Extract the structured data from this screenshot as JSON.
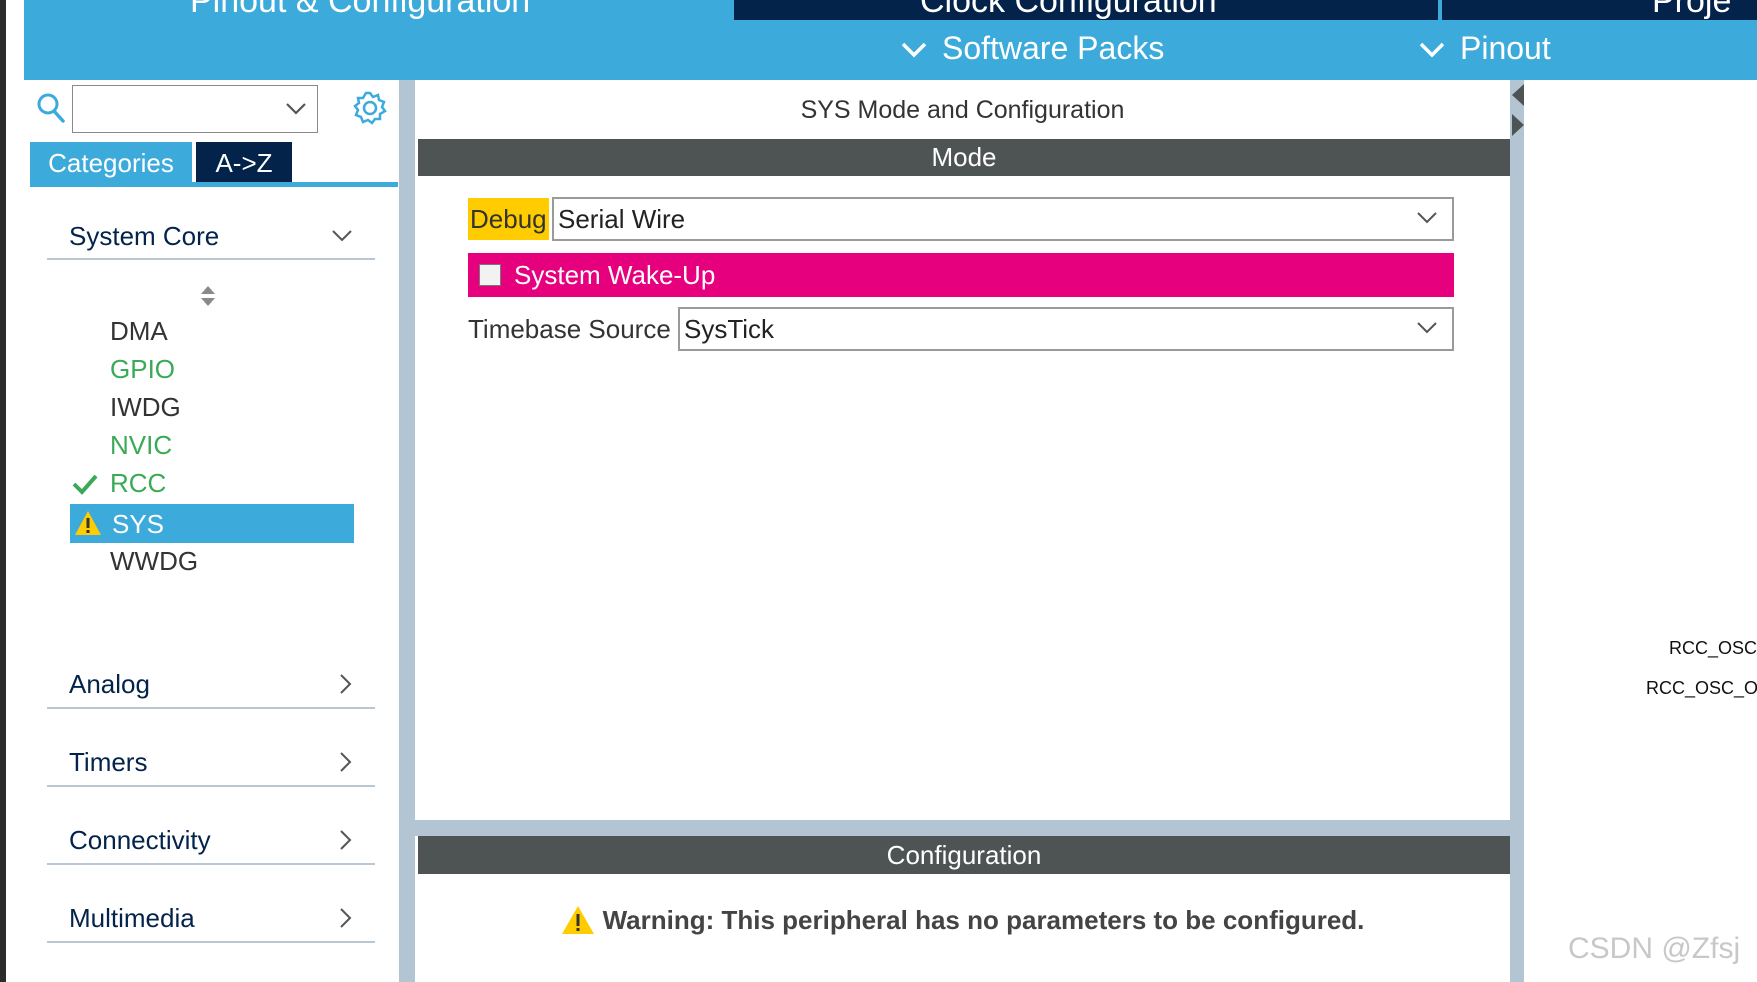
{
  "top_tabs": {
    "pinout_config": "Pinout & Configuration",
    "clock_config": "Clock Configuration",
    "project": "Proje"
  },
  "sub_toolbar": {
    "software_packs": "Software Packs",
    "pinout": "Pinout"
  },
  "sidebar": {
    "search_value": "",
    "tab_categories": "Categories",
    "tab_az": "A->Z",
    "groups": {
      "system_core": "System Core",
      "analog": "Analog",
      "timers": "Timers",
      "connectivity": "Connectivity",
      "multimedia": "Multimedia"
    },
    "items": [
      {
        "label": "DMA",
        "color": "#333333",
        "status": ""
      },
      {
        "label": "GPIO",
        "color": "#3aaa57",
        "status": ""
      },
      {
        "label": "IWDG",
        "color": "#333333",
        "status": ""
      },
      {
        "label": "NVIC",
        "color": "#3aaa57",
        "status": ""
      },
      {
        "label": "RCC",
        "color": "#3aaa57",
        "status": "check-icon"
      },
      {
        "label": "SYS",
        "color": "#ffffff",
        "status": "warning-icon",
        "selected": true
      },
      {
        "label": "WWDG",
        "color": "#333333",
        "status": ""
      }
    ]
  },
  "main": {
    "title": "SYS Mode and Configuration",
    "mode_header": "Mode",
    "debug_label": "Debug",
    "debug_value": "Serial Wire",
    "wakeup_label": "System Wake-Up",
    "timebase_label": "Timebase Source",
    "timebase_value": "SysTick",
    "config_header": "Configuration",
    "warning_text": "Warning: This peripheral has no parameters to be configured."
  },
  "right_panel": {
    "pin1": "RCC_OSC",
    "pin2": "RCC_OSC_O"
  },
  "watermark": "CSDN @Zfsj",
  "colors": {
    "accent": "#3cabdb",
    "dark_navy": "#03234b",
    "header_gray": "#4e5453",
    "wakeup_magenta": "#e6007e",
    "debug_yellow": "#ffcc00",
    "green": "#3aaa57"
  }
}
